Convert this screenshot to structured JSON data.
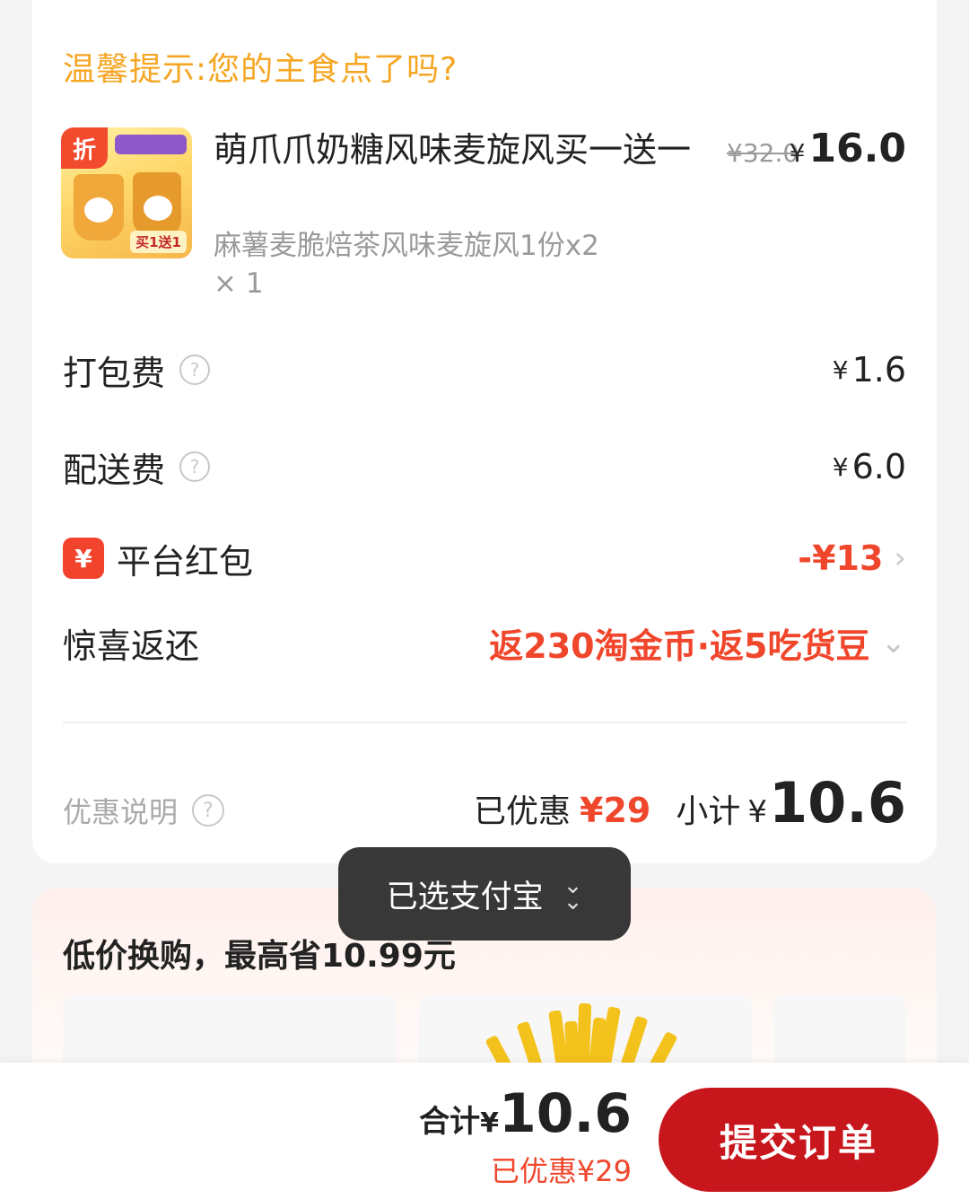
{
  "tip": "温馨提示:您的主食点了吗?",
  "product": {
    "tag": "折",
    "image_badge": "买1送1",
    "name": "萌爪爪奶糖风味麦旋风买一送一",
    "desc": "麻薯麦脆焙茶风味麦旋风1份x2",
    "qty": "× 1",
    "price_old": "¥32.0",
    "price_symbol": "¥",
    "price_now": "16.0"
  },
  "fees": {
    "packing_label": "打包费",
    "packing_value": "1.6",
    "delivery_label": "配送费",
    "delivery_value": "6.0",
    "yen": "¥",
    "help_glyph": "?"
  },
  "redpacket": {
    "icon_glyph": "¥",
    "label": "平台红包",
    "value": "-¥13"
  },
  "surprise": {
    "label": "惊喜返还",
    "value": "返230淘金币·返5吃货豆"
  },
  "summary": {
    "left_label": "优惠说明",
    "discount_label": "已优惠",
    "discount_value": "¥29",
    "subtotal_label": "小计",
    "yen": "¥",
    "subtotal_value": "10.6"
  },
  "toast": {
    "text": "已选支付宝"
  },
  "promo": {
    "title": "低价换购，最高省10.99元"
  },
  "bottom": {
    "total_label": "合计",
    "yen": "¥",
    "total_value": "10.6",
    "saved": "已优惠¥29",
    "submit": "提交订单"
  },
  "colors": {
    "accent_red": "#f0462c",
    "submit_red": "#c8161d",
    "tip_orange": "#f5a623"
  }
}
